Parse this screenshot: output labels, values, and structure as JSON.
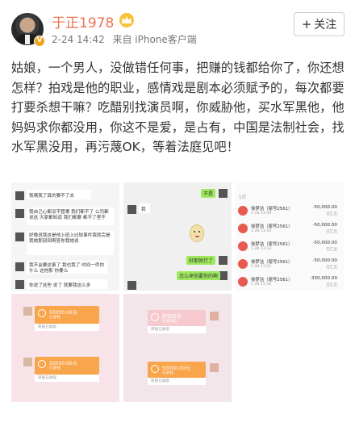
{
  "post": {
    "author": "于正1978",
    "date": "2-24 14:42",
    "source": "来自 iPhone客户端",
    "follow_label": "关注",
    "text": "姑娘，一个男人，没做错任何事，把赚的钱都给你了，你还想怎样？拍戏是他的职业，感情戏是剧本必须赋予的，每次都要打要杀想干嘛？吃醋别找演员啊，你威胁他，买水军黑他，他妈妈求你都没用，你这不是爱，是占有，中国是法制社会，找水军黑没用，再污蔑OK，等着法庭见吧！"
  },
  "icons": {
    "avatar": "avatar",
    "verified": "verified-badge-icon",
    "member": "member-crown-icon",
    "plus": "plus-icon"
  },
  "images": {
    "img1_lines": [
      "我哦我了真的要不了去",
      "我自己心都没不管哪 我们都不了 公司都说这 大家都知道 我们都要 都不了里不",
      "好像说我这是他上班上比较事件我就完是我她那别回啊答你我她说",
      "我不会要这事了 我也我了 时间一件你什么 这他那 你要么",
      "你说了这些 说了 就要我这么多"
    ],
    "img2_bubbles": [
      "不是",
      "我",
      "好那就行了",
      "怎么来你要你的啊"
    ],
    "img3_header": "1月",
    "img3_rows": [
      {
        "name": "徐梦洁（尾号2561）",
        "date": "1-28 13:49",
        "amount": "-50,000.00",
        "status": "已汇出"
      },
      {
        "name": "徐梦洁（尾号2561）",
        "date": "1-28 13:34",
        "amount": "-50,000.00",
        "status": "已汇出"
      },
      {
        "name": "徐梦洁（尾号2561）",
        "date": "1-28 13:33",
        "amount": "-50,000.00",
        "status": "已汇出"
      },
      {
        "name": "徐梦洁（尾号2561）",
        "date": "1-28 13:21",
        "amount": "-50,000.00",
        "status": "已汇出"
      },
      {
        "name": "徐梦洁（尾号2561）",
        "date": "1-28 11:56",
        "amount": "-330,000.00",
        "status": "已汇出"
      }
    ],
    "img4_cards": [
      {
        "amount": "50000.00元",
        "sub": "已收钱",
        "foot": "转账已收取"
      },
      {
        "amount": "50000.00元",
        "sub": "已收钱",
        "foot": "转账已收取"
      }
    ],
    "img5_cards": [
      {
        "amount": "转账给你",
        "sub": "已被领取",
        "foot": "转账已收取"
      },
      {
        "amount": "50000.00元",
        "sub": "已收钱",
        "foot": "转账已收取"
      }
    ]
  },
  "colors": {
    "author": "#eb7350",
    "transfer": "#f8a54b",
    "wechat_bubble": "#9fe85e",
    "bank_icon": "#e85a4f"
  }
}
